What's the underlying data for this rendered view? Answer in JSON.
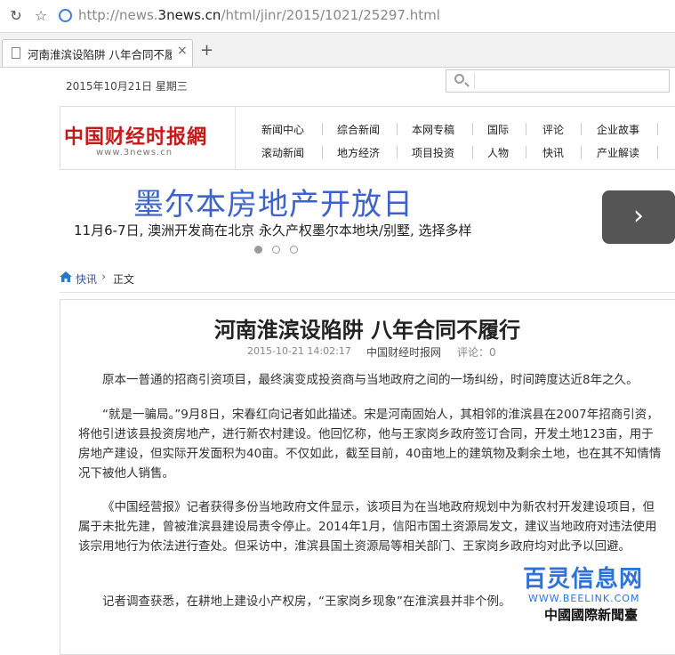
{
  "browser": {
    "url_prefix": "http://news.",
    "url_domain": "3news.cn",
    "url_path": "/html/jinr/2015/1021/25297.html",
    "tab_title": "河南淮滨设陷阱 八年合同不履行",
    "new_tab_label": "+",
    "close_tab_label": "×"
  },
  "top": {
    "date": "2015年10月21日 星期三",
    "search_placeholder": ""
  },
  "header": {
    "logo_text": "中国财经时报網",
    "logo_url": "www.3news.cn",
    "nav_row1": [
      "新闻中心",
      "综合新闻",
      "本网专稿",
      "国际",
      "评论",
      "企业故事"
    ],
    "nav_row2": [
      "滚动新闻",
      "地方经济",
      "项目投资",
      "人物",
      "快讯",
      "产业解读"
    ]
  },
  "banner": {
    "title": "墨尔本房地产开放日",
    "subtitle": "11月6-7日, 澳洲开发商在北京 永久产权墨尔本地块/别墅, 选择多样",
    "next_label": "›"
  },
  "breadcrumb": {
    "section": "快讯",
    "separator": "›",
    "current": "正文"
  },
  "article": {
    "title": "河南淮滨设陷阱  八年合同不履行",
    "time": "2015-10-21 14:02:17",
    "source": "中国财经时报网",
    "comment": "评论：0",
    "paragraphs": [
      "原本一普通的招商引资项目，最终演变成投资商与当地政府之间的一场纠纷，时间跨度达近8年之久。",
      "“就是一骗局。”9月8日，宋春红向记者如此描述。宋是河南固始人，其相邻的淮滨县在2007年招商引资，将他引进该县投资房地产，进行新农村建设。他回忆称，他与王家岗乡政府签订合同，开发土地123亩，用于房地产建设，但实际开发面积为40亩。不仅如此，截至目前，40亩地上的建筑物及剩余土地，也在其不知情情况下被他人销售。",
      "《中国经营报》记者获得多份当地政府文件显示，该项目为在当地政府规划中为新农村开发建设项目，但属于未批先建，曾被淮滨县建设局责令停止。2014年1月，信阳市国土资源局发文，建议当地政府对违法使用该宗用地行为依法进行查处。但采访中，淮滨县国土资源局等相关部门、王家岗乡政府均对此予以回避。",
      "记者调查获悉，在耕地上建设小产权房，“王家岗乡现象”在淮滨县并非个例。"
    ]
  },
  "watermark": {
    "top": "百灵信息网",
    "url": "WWW.BEELINK.COM",
    "bottom": "中國國際新聞臺"
  }
}
